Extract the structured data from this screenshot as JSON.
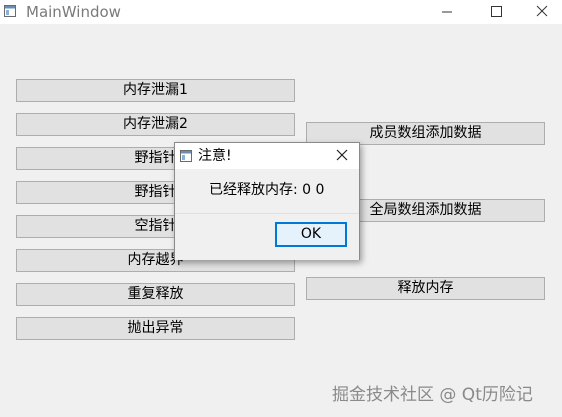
{
  "window": {
    "title": "MainWindow",
    "minimize_icon": "minimize-icon",
    "maximize_icon": "maximize-icon",
    "close_icon": "close-icon"
  },
  "left_buttons": [
    {
      "label": "内存泄漏1"
    },
    {
      "label": "内存泄漏2"
    },
    {
      "label": "野指针"
    },
    {
      "label": "野指针"
    },
    {
      "label": "空指针"
    },
    {
      "label": "内存越界"
    },
    {
      "label": "重复释放"
    },
    {
      "label": "抛出异常"
    }
  ],
  "right_buttons": [
    {
      "label": "成员数组添加数据"
    },
    {
      "label": "全局数组添加数据"
    },
    {
      "label": "释放内存"
    }
  ],
  "dialog": {
    "title": "注意!",
    "message": "已经释放内存: 0  0",
    "ok_label": "OK"
  },
  "watermark": "掘金技术社区 @ Qt历险记",
  "colors": {
    "accent": "#0078d7",
    "button_bg": "#e1e1e1",
    "window_bg": "#f0f0f0"
  }
}
